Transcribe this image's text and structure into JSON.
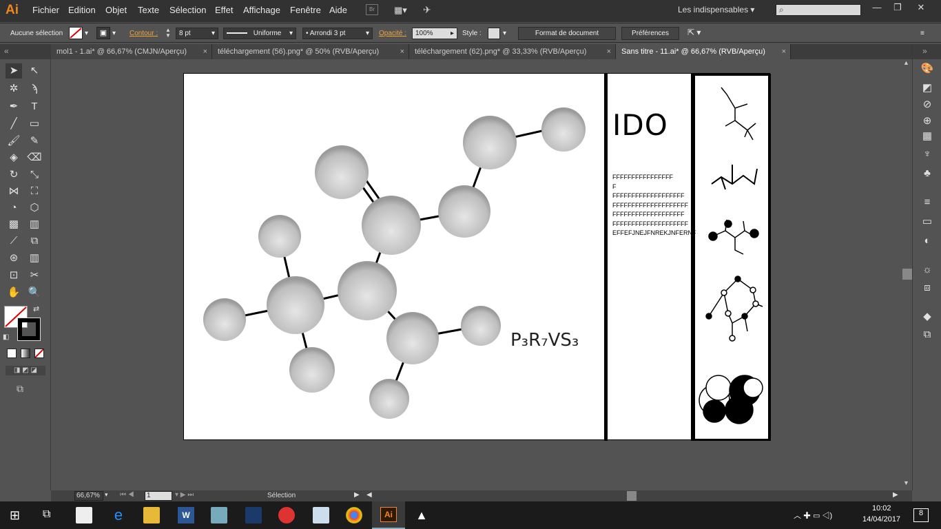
{
  "app": {
    "logo": "Ai"
  },
  "menu": [
    "Fichier",
    "Edition",
    "Objet",
    "Texte",
    "Sélection",
    "Effet",
    "Affichage",
    "Fenêtre",
    "Aide"
  ],
  "bridge_label": "Br",
  "workspace": "Les indispensables",
  "search_placeholder": "",
  "control": {
    "selection": "Aucune sélection",
    "contour_label": "Contour :",
    "stroke_weight": "8 pt",
    "stroke_type": "Uniforme",
    "brush": "Arrondi 3 pt",
    "opacity_label": "Opacité :",
    "opacity": "100%",
    "style_label": "Style :",
    "doc_format": "Format de document",
    "preferences": "Préférences"
  },
  "tabs": [
    {
      "label": "mol1 - 1.ai* @ 66,67% (CMJN/Aperçu)",
      "active": false
    },
    {
      "label": "téléchargement (56).png* @ 50% (RVB/Aperçu)",
      "active": false
    },
    {
      "label": "téléchargement (62).png* @ 33,33% (RVB/Aperçu)",
      "active": false
    },
    {
      "label": "Sans titre - 11.ai* @ 66,67% (RVB/Aperçu)",
      "active": true
    }
  ],
  "artboard": {
    "title": "IDO",
    "lines": [
      "FFFFFFFFFFFFFFFF",
      "F",
      "FFFFFFFFFFFFFFFFFFF",
      "FFFFFFFFFFFFFFFFFFFF",
      "FFFFFFFFFFFFFFFFFFF",
      "FFFFFFFFFFFFFFFFFFFF",
      "EFFEFJNEJFNREKJNFERNF"
    ],
    "formula": "P₃R₇VS₃"
  },
  "status": {
    "zoom": "66,67%",
    "page": "1",
    "tool": "Sélection"
  },
  "taskbar": {
    "time": "10:02",
    "date": "14/04/2017",
    "notif": "8"
  },
  "colors": {
    "accent": "#f2861f",
    "chrome": "#323232",
    "panel": "#535353"
  }
}
